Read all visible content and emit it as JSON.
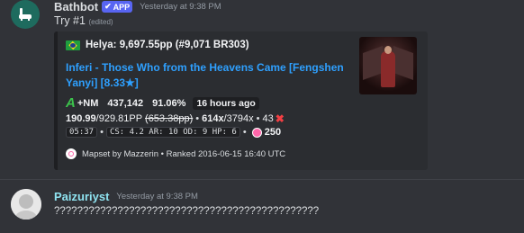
{
  "messages": [
    {
      "author": "Bathbot",
      "badge": "APP",
      "timestamp": "Yesterday at 9:38 PM",
      "content": "Try #1",
      "edited": "(edited)",
      "name_color": "#dbdee1"
    },
    {
      "author": "Paizuriyst",
      "timestamp": "Yesterday at 9:38 PM",
      "content": "??????????????????????????????????????????????",
      "name_color": "#8fe3f0"
    }
  ],
  "embed": {
    "author": "Helya: 9,697.55pp (#9,071 BR303)",
    "title": "Inferi - Those Who from the Heavens Came [Fengshen Yanyi] [8.33★]",
    "grade": "A",
    "mods": "+NM",
    "score": "437,142",
    "accuracy": "91.06%",
    "time_ago": "16 hours ago",
    "pp": "190.99",
    "pp_max": "/929.81PP",
    "pp_fc": "(653.38pp)",
    "combo": "614x",
    "max_combo": "/3794x",
    "misses": "43",
    "miss_icon": "✖",
    "length": "05:37",
    "map_stats": "CS: 4.2  AR: 10  OD: 9  HP: 6",
    "circles": "250",
    "footer": "Mapset by Mazzerin • Ranked 2016-06-15 16:40 UTC",
    "link_color": "#2ea0ff"
  }
}
